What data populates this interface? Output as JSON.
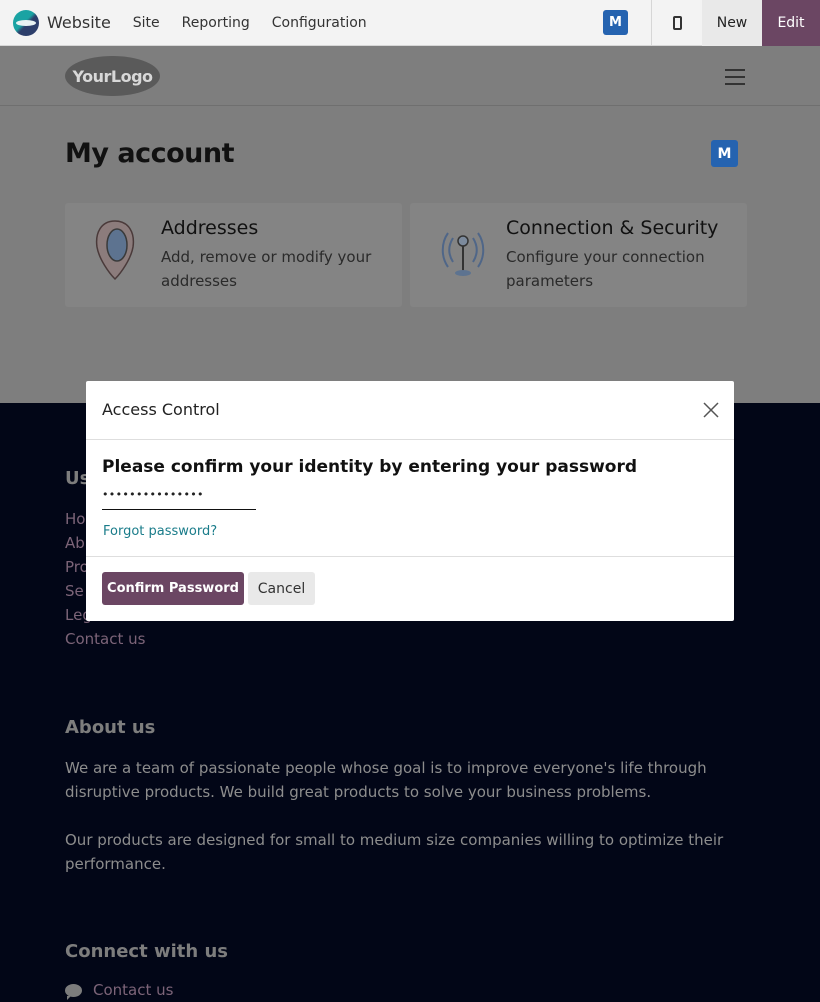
{
  "topbar": {
    "brand": "Website",
    "menu": [
      "Site",
      "Reporting",
      "Configuration"
    ],
    "user_initial": "M",
    "new_label": "New",
    "edit_label": "Edit",
    "accent": "#6b4663"
  },
  "header": {
    "logo_text": "YourLogo"
  },
  "main": {
    "title": "My account",
    "user_initial": "M",
    "cards": [
      {
        "title": "Addresses",
        "description": "Add, remove or modify your addresses",
        "icon": "map-pin-icon"
      },
      {
        "title": "Connection & Security",
        "description": "Configure your connection parameters",
        "icon": "antenna-icon"
      }
    ]
  },
  "footer": {
    "links_heading_partial": "Us",
    "links_partial": [
      "Ho",
      "Ab",
      "Pro",
      "Se",
      "Leg"
    ],
    "contact_link": "Contact us",
    "about_heading": "About us",
    "about_p1": "We are a team of passionate people whose goal is to improve everyone's life through disruptive products. We build great products to solve your business problems.",
    "about_p2": "Our products are designed for small to medium size companies willing to optimize their performance.",
    "connect_heading": "Connect with us",
    "connect_contact": "Contact us"
  },
  "modal": {
    "title": "Access Control",
    "prompt": "Please confirm your identity by entering your password",
    "password_mask": "•••••••••••••••",
    "forgot_label": "Forgot password?",
    "confirm_label": "Confirm Password",
    "cancel_label": "Cancel"
  }
}
